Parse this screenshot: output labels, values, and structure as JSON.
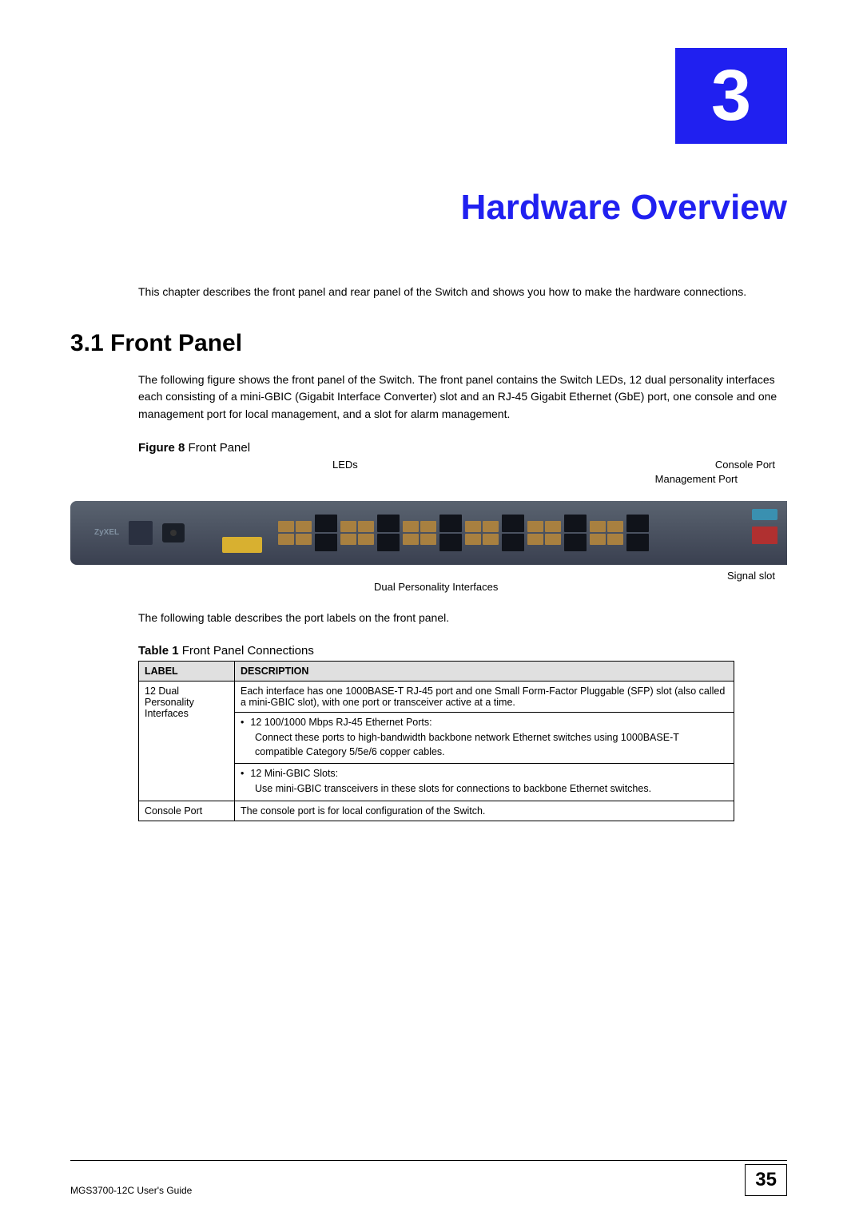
{
  "chapter": {
    "number": "3",
    "title": "Hardware Overview"
  },
  "intro": "This chapter describes the front panel and rear panel of the Switch and shows you how to make the hardware connections.",
  "section": {
    "heading": "3.1  Front Panel",
    "body": "The following figure shows the front panel of the Switch. The front panel contains the Switch LEDs, 12 dual personality interfaces each consisting of a mini-GBIC (Gigabit Interface Converter) slot and an RJ-45 Gigabit Ethernet (GbE) port, one console and one management port for local management, and a slot for alarm management."
  },
  "figure": {
    "caption_bold": "Figure 8",
    "caption_rest": "   Front Panel",
    "labels": {
      "leds": "LEDs",
      "console": "Console Port",
      "mgmt": "Management Port",
      "dual": "Dual Personality Interfaces",
      "signal": "Signal slot"
    }
  },
  "table_intro": "The following table describes the port labels on the front panel.",
  "table": {
    "caption_bold": "Table 1",
    "caption_rest": "   Front Panel Connections",
    "header": {
      "c1": "LABEL",
      "c2": "DESCRIPTION"
    },
    "rows": {
      "r1": {
        "label": "12 Dual Personality Interfaces",
        "desc": "Each interface has one 1000BASE-T RJ-45 port and one Small Form-Factor Pluggable (SFP) slot (also called a mini-GBIC slot), with one port or transceiver active at a time."
      },
      "r2": {
        "bullet": "12 100/1000 Mbps RJ-45 Ethernet Ports:",
        "body": "Connect these ports to high-bandwidth backbone network Ethernet switches using 1000BASE-T compatible Category 5/5e/6 copper cables."
      },
      "r3": {
        "bullet": "12 Mini-GBIC Slots:",
        "body": "Use mini-GBIC transceivers in these slots for connections to backbone Ethernet switches."
      },
      "r4": {
        "label": "Console Port",
        "desc": "The console port is for local configuration of the Switch."
      }
    }
  },
  "footer": {
    "guide": "MGS3700-12C User's Guide",
    "page": "35"
  }
}
